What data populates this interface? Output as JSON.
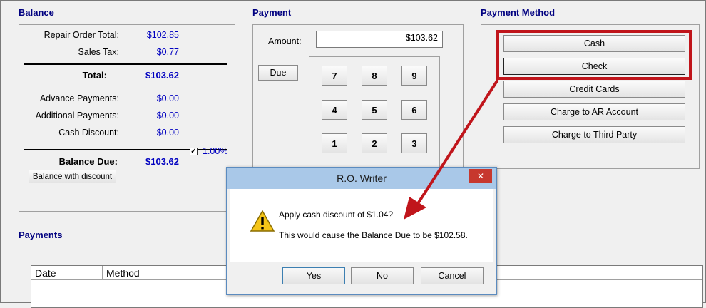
{
  "balance": {
    "title": "Balance",
    "rows": [
      {
        "label": "Repair Order Total:",
        "value": "$102.85"
      },
      {
        "label": "Sales Tax:",
        "value": "$0.77"
      },
      {
        "label": "Total:",
        "value": "$103.62"
      },
      {
        "label": "Advance Payments:",
        "value": "$0.00"
      },
      {
        "label": "Additional Payments:",
        "value": "$0.00"
      },
      {
        "label": "Cash Discount:",
        "value": "$0.00"
      },
      {
        "label": "Balance Due:",
        "value": "$103.62"
      }
    ],
    "discount_checked": true,
    "discount_percent": "1.00%",
    "balance_with_discount_label": "Balance with discount"
  },
  "payment": {
    "title": "Payment",
    "amount_label": "Amount:",
    "amount_value": "$103.62",
    "due_label": "Due",
    "keys": [
      "7",
      "8",
      "9",
      "4",
      "5",
      "6",
      "1",
      "2",
      "3"
    ]
  },
  "payment_method": {
    "title": "Payment Method",
    "buttons": [
      "Cash",
      "Check",
      "Credit Cards",
      "Charge to AR Account",
      "Charge to Third Party"
    ]
  },
  "payments": {
    "title": "Payments",
    "columns": [
      "Date",
      "Method"
    ]
  },
  "dialog": {
    "title": "R.O. Writer",
    "close": "✕",
    "line1": "Apply cash discount of $1.04?",
    "line2": "This would cause the Balance Due to be  $102.58.",
    "yes": "Yes",
    "no": "No",
    "cancel": "Cancel"
  },
  "colors": {
    "annotation": "#c0151b",
    "value_text": "#0000c0",
    "section_title": "#000080"
  }
}
